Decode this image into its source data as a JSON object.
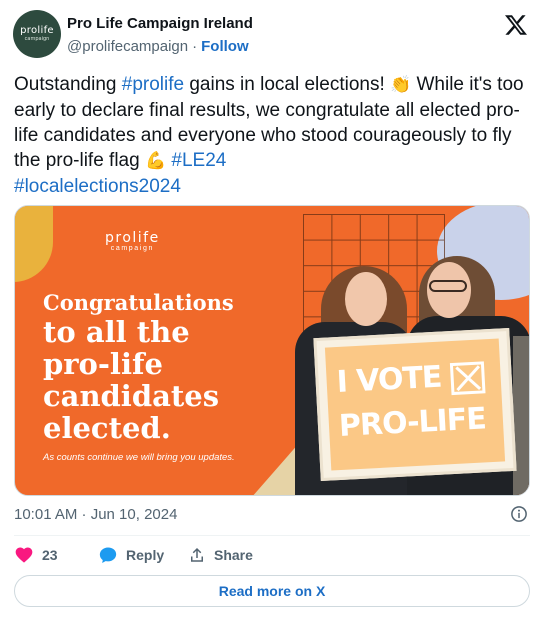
{
  "author": {
    "name": "Pro Life Campaign Ireland",
    "handle": "@prolifecampaign",
    "separator": "·",
    "follow_label": "Follow",
    "avatar_text": "prolife",
    "avatar_subtext": "campaign"
  },
  "tweet": {
    "part1": "Outstanding ",
    "tag_prolife": "#prolife",
    "part2": " gains in local elections! ",
    "emoji_clap": "👏",
    "part3": " While it's too early to declare final results, we congratulate all elected pro-life candidates and everyone who stood courageously to fly the pro-life flag ",
    "emoji_muscle": "💪",
    "tag_le24": "#LE24",
    "tag_localelections": "#localelections2024"
  },
  "media": {
    "brand": "prolife",
    "brand_sub": "campaign",
    "headline_line1": "Congratulations",
    "headline_line2": "to all the",
    "headline_line3": "pro-life",
    "headline_line4": "candidates",
    "headline_line5": "elected.",
    "subtext": "As counts continue we will bring you updates.",
    "sign_line1": "I VOTE",
    "sign_line2": "PRO-LIFE"
  },
  "footer": {
    "timestamp": "10:01 AM · Jun 10, 2024",
    "like_count": "23",
    "reply_label": "Reply",
    "share_label": "Share",
    "read_more": "Read more on X"
  },
  "colors": {
    "link": "#1d6ec5",
    "like": "#f91880",
    "reply_icon": "#1d9bf0",
    "media_bg": "#f0692a"
  },
  "icons": [
    "x-logo-icon",
    "info-icon",
    "heart-icon",
    "reply-bubble-icon",
    "share-icon"
  ]
}
